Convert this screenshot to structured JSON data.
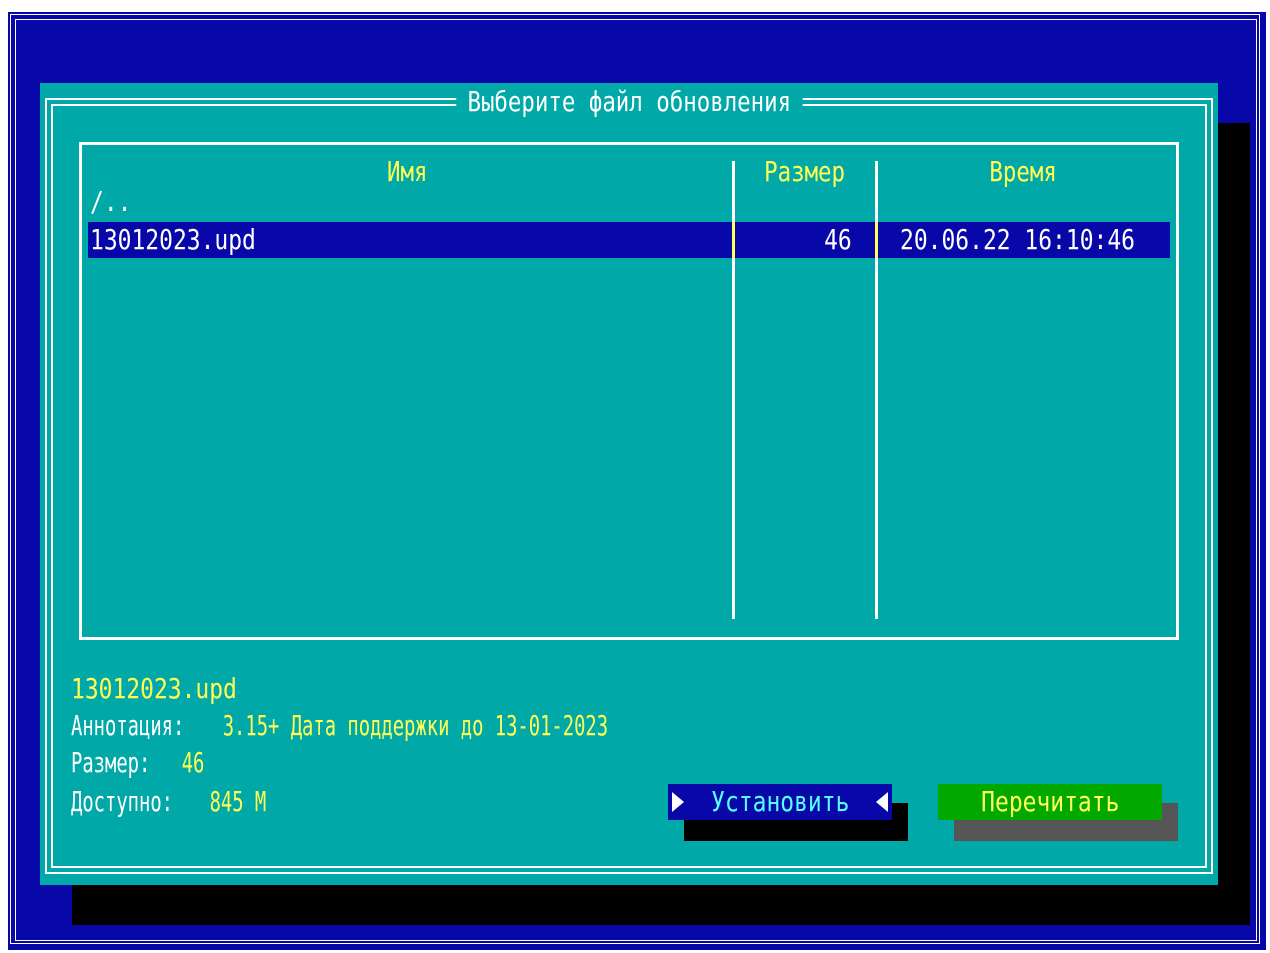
{
  "dialog": {
    "title": "Выберите файл обновления"
  },
  "list": {
    "columns": {
      "name": "Имя",
      "size": "Размер",
      "time": "Время"
    },
    "rows": [
      {
        "name": "/..",
        "size": "",
        "time": ""
      },
      {
        "name": "13012023.upd",
        "size": "46",
        "time": "20.06.22 16:10:46",
        "selected": true
      }
    ]
  },
  "info": {
    "filename": "13012023.upd",
    "annotation_label": "Аннотация:",
    "annotation_value": "3.15+ Дата поддержки до 13-01-2023",
    "size_label": "Размер:",
    "size_value": "46",
    "available_label": "Доступно:",
    "available_value": "845 М"
  },
  "buttons": {
    "install": "Установить",
    "reread": "Перечитать"
  },
  "colors": {
    "screen_bg": "#0808a8",
    "dialog_bg": "#00a8a8",
    "highlight_text": "#ffff55",
    "install_btn_bg": "#0808a8",
    "reread_btn_bg": "#00a800"
  }
}
